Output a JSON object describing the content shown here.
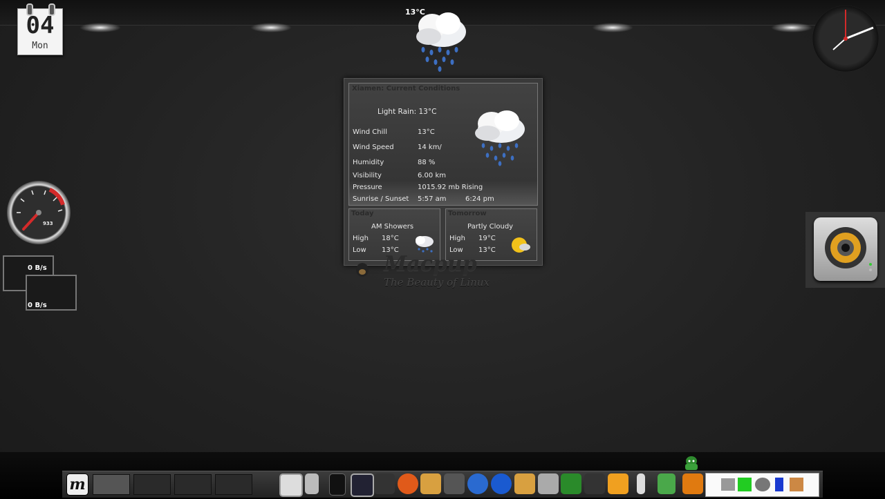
{
  "calendar": {
    "day": "04",
    "weekday": "Mon"
  },
  "top_weather": {
    "temp": "13°C"
  },
  "weather": {
    "current_header": "Xiamen: Current Conditions",
    "condition": "Light Rain: 13°C",
    "rows": [
      {
        "label": "Wind Chill",
        "value": "13°C"
      },
      {
        "label": "Wind Speed",
        "value": "14 km/"
      },
      {
        "label": "Humidity",
        "value": "88 %"
      },
      {
        "label": "Visibility",
        "value": "6.00 km"
      },
      {
        "label": "Pressure",
        "value": "1015.92 mb Rising"
      },
      {
        "label": "Sunrise / Sunset",
        "value": "5:57 am",
        "value2": "6:24 pm"
      }
    ],
    "today": {
      "header": "Today",
      "condition": "AM Showers",
      "high_label": "High",
      "high": "18°C",
      "low_label": "Low",
      "low": "13°C"
    },
    "tomorrow": {
      "header": "Tomorrow",
      "condition": "Partly Cloudy",
      "high_label": "High",
      "high": "19°C",
      "low_label": "Low",
      "low": "13°C"
    }
  },
  "logo": {
    "title": "Macpup",
    "tagline": "The Beauty of Linux"
  },
  "gauge": {
    "value": "933"
  },
  "network": {
    "rate1": "0 B/s",
    "rate2": "0 B/s"
  },
  "taskbar": {
    "menu_icon": "macpup-menu-icon",
    "launchers": [
      "terminal-icon",
      "usb-drive-icon",
      "phone-icon",
      "system-monitor-icon",
      "magic-hat-icon",
      "browser-icon",
      "pet-home-icon",
      "camera-icon",
      "help-icon",
      "power-icon",
      "pet-package-icon",
      "calculator-icon",
      "monkey-icon",
      "mixer-icon",
      "chat-icon",
      "thermometer-icon",
      "trash-icon",
      "orange-app-icon"
    ],
    "tray_icons": [
      "volume-icon",
      "network-stack-icon",
      "network-globe-icon",
      "battery-icon",
      "update-icon"
    ]
  },
  "colors": {
    "accent_red": "#d42a2a",
    "rain_blue": "#3d6fc2",
    "sun_yellow": "#f2c21a"
  }
}
